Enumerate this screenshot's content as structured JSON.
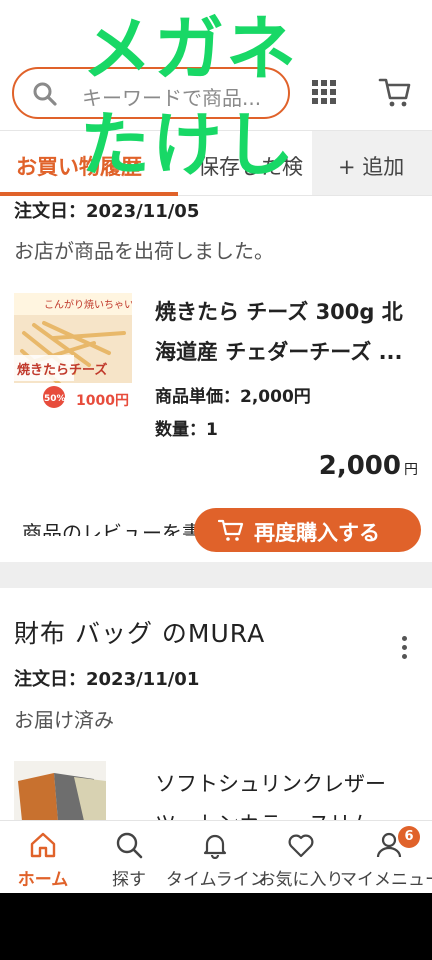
{
  "watermark": {
    "line1": "メガネ",
    "line2": "たけし"
  },
  "header": {
    "search_placeholder": "キーワードで商品...",
    "icons": {
      "search": "search-icon",
      "grid": "grid-icon",
      "cart": "cart-icon"
    }
  },
  "tabs": {
    "active_label": "お買い物履歴",
    "second_label": "保存した検",
    "add_label": "+ 追加"
  },
  "orders": [
    {
      "date_label": "注文日：2023/11/05",
      "status": "お店が商品を出荷しました。",
      "product": {
        "title_line1": "焼きたら チーズ 300g 北",
        "title_line2": "海道産 チェダーチーズ ...",
        "unit_price_label": "商品単価：2,000円",
        "quantity_label": "数量：1",
        "price": "2,000",
        "price_unit": "円",
        "thumb_text": {
          "top": "こんがり焼いちゃいました！",
          "brand": "焼きたらチーズ",
          "discount": "50%",
          "price": "1000円"
        }
      },
      "review_text": "商品のレビューを書く",
      "rebuy_label": "再度購入する"
    },
    {
      "shop_name": "財布 バッグ のMURA",
      "date_label": "注文日：2023/11/01",
      "status": "お届け済み",
      "product": {
        "title_line1": "ソフトシュリンクレザー",
        "title_line2": "ツートンカラー スリム"
      }
    }
  ],
  "bottom_nav": [
    {
      "label": "ホーム",
      "icon": "home-icon",
      "active": true
    },
    {
      "label": "探す",
      "icon": "search-icon",
      "active": false
    },
    {
      "label": "タイムライン",
      "icon": "bell-icon",
      "active": false
    },
    {
      "label": "お気に入り",
      "icon": "heart-icon",
      "active": false
    },
    {
      "label": "マイメニュー",
      "icon": "person-icon",
      "active": false
    }
  ],
  "badge_count": "6",
  "colors": {
    "accent": "#e0622a",
    "watermark": "#18d866",
    "separator": "#eeeeee"
  }
}
